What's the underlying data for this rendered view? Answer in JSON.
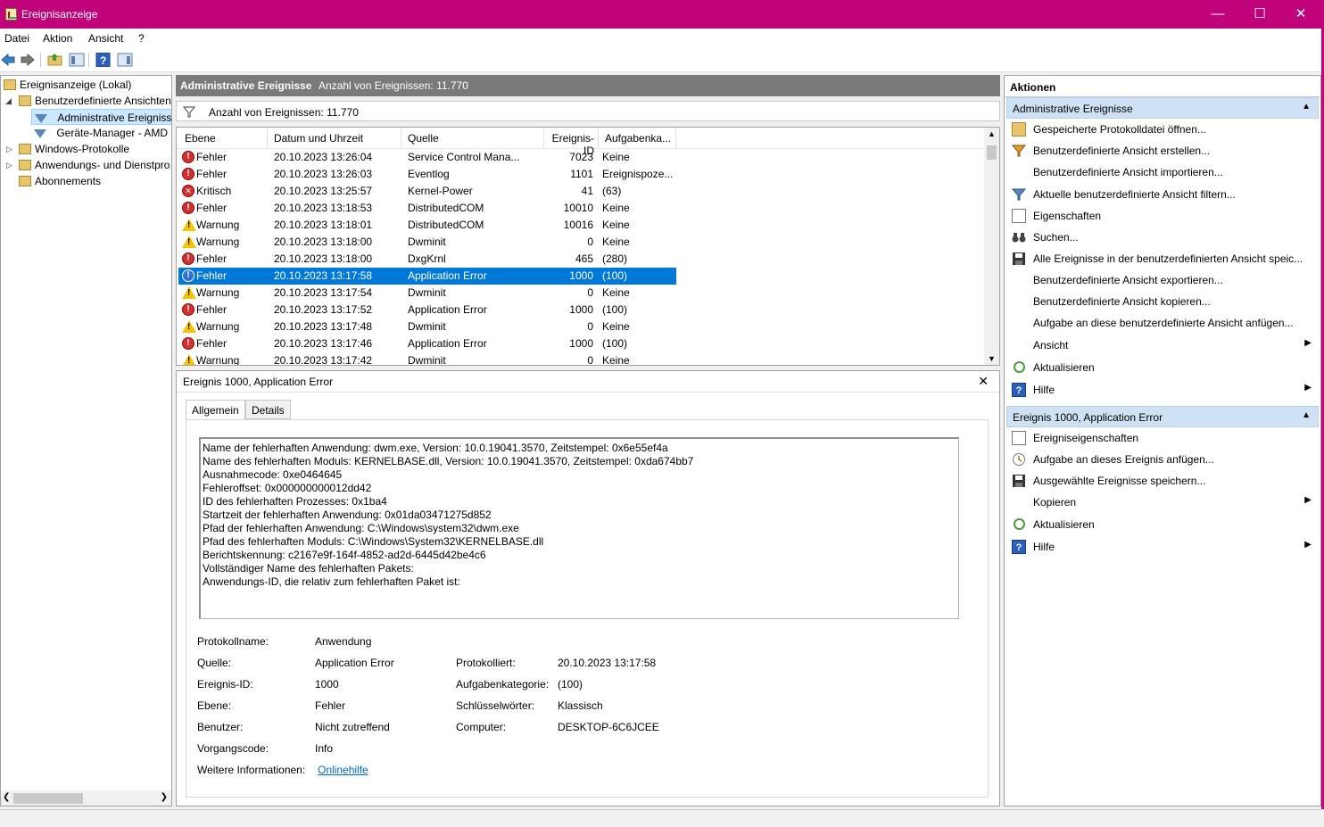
{
  "window": {
    "title": "Ereignisanzeige"
  },
  "menu": [
    "Datei",
    "Aktion",
    "Ansicht",
    "?"
  ],
  "tree": {
    "root": "Ereignisanzeige (Lokal)",
    "custom_views": "Benutzerdefinierte Ansichten",
    "admin_events": "Administrative Ereignisse",
    "device_manager": "Geräte-Manager - AMD F",
    "windows_logs": "Windows-Protokolle",
    "app_service_logs": "Anwendungs- und Dienstpro",
    "subscriptions": "Abonnements"
  },
  "center": {
    "header_title": "Administrative Ereignisse",
    "header_count": "Anzahl von Ereignissen: 11.770",
    "filter_text": "Anzahl von Ereignissen: 11.770",
    "columns": [
      "Ebene",
      "Datum und Uhrzeit",
      "Quelle",
      "Ereignis-ID",
      "Aufgabenka..."
    ],
    "rows": [
      {
        "level": "Fehler",
        "type": "error",
        "date": "20.10.2023 13:26:04",
        "source": "Service Control Mana...",
        "id": "7023",
        "task": "Keine"
      },
      {
        "level": "Fehler",
        "type": "error",
        "date": "20.10.2023 13:26:03",
        "source": "Eventlog",
        "id": "1101",
        "task": "Ereignispoze..."
      },
      {
        "level": "Kritisch",
        "type": "critical",
        "date": "20.10.2023 13:25:57",
        "source": "Kernel-Power",
        "id": "41",
        "task": "(63)"
      },
      {
        "level": "Fehler",
        "type": "error",
        "date": "20.10.2023 13:18:53",
        "source": "DistributedCOM",
        "id": "10010",
        "task": "Keine"
      },
      {
        "level": "Warnung",
        "type": "warning",
        "date": "20.10.2023 13:18:01",
        "source": "DistributedCOM",
        "id": "10016",
        "task": "Keine"
      },
      {
        "level": "Warnung",
        "type": "warning",
        "date": "20.10.2023 13:18:00",
        "source": "Dwminit",
        "id": "0",
        "task": "Keine"
      },
      {
        "level": "Fehler",
        "type": "error",
        "date": "20.10.2023 13:18:00",
        "source": "DxgKrnl",
        "id": "465",
        "task": "(280)"
      },
      {
        "level": "Fehler",
        "type": "error",
        "date": "20.10.2023 13:17:58",
        "source": "Application Error",
        "id": "1000",
        "task": "(100)",
        "selected": true
      },
      {
        "level": "Warnung",
        "type": "warning",
        "date": "20.10.2023 13:17:54",
        "source": "Dwminit",
        "id": "0",
        "task": "Keine"
      },
      {
        "level": "Fehler",
        "type": "error",
        "date": "20.10.2023 13:17:52",
        "source": "Application Error",
        "id": "1000",
        "task": "(100)"
      },
      {
        "level": "Warnung",
        "type": "warning",
        "date": "20.10.2023 13:17:48",
        "source": "Dwminit",
        "id": "0",
        "task": "Keine"
      },
      {
        "level": "Fehler",
        "type": "error",
        "date": "20.10.2023 13:17:46",
        "source": "Application Error",
        "id": "1000",
        "task": "(100)"
      },
      {
        "level": "Warnung",
        "type": "warning",
        "date": "20.10.2023 13:17:42",
        "source": "Dwminit",
        "id": "0",
        "task": "Keine"
      }
    ]
  },
  "detail": {
    "title": "Ereignis 1000, Application Error",
    "tabs": [
      "Allgemein",
      "Details"
    ],
    "description": [
      "Name der fehlerhaften Anwendung: dwm.exe, Version: 10.0.19041.3570, Zeitstempel: 0x6e55ef4a",
      "Name des fehlerhaften Moduls: KERNELBASE.dll, Version: 10.0.19041.3570, Zeitstempel: 0xda674bb7",
      "Ausnahmecode: 0xe0464645",
      "Fehleroffset: 0x000000000012dd42",
      "ID des fehlerhaften Prozesses: 0x1ba4",
      "Startzeit der fehlerhaften Anwendung: 0x01da03471275d852",
      "Pfad der fehlerhaften Anwendung: C:\\Windows\\system32\\dwm.exe",
      "Pfad des fehlerhaften Moduls: C:\\Windows\\System32\\KERNELBASE.dll",
      "Berichtskennung: c2167e9f-164f-4852-ad2d-6445d42be4c6",
      "Vollständiger Name des fehlerhaften Pakets:",
      "Anwendungs-ID, die relativ zum fehlerhaften Paket ist:"
    ],
    "fields": {
      "log_name_label": "Protokollname:",
      "log_name": "Anwendung",
      "source_label": "Quelle:",
      "source": "Application Error",
      "logged_label": "Protokolliert:",
      "logged": "20.10.2023 13:17:58",
      "event_id_label": "Ereignis-ID:",
      "event_id": "1000",
      "task_cat_label": "Aufgabenkategorie:",
      "task_cat": "(100)",
      "level_label": "Ebene:",
      "level": "Fehler",
      "keywords_label": "Schlüsselwörter:",
      "keywords": "Klassisch",
      "user_label": "Benutzer:",
      "user": "Nicht zutreffend",
      "computer_label": "Computer:",
      "computer": "DESKTOP-6C6JCEE",
      "opcode_label": "Vorgangscode:",
      "opcode": "Info",
      "more_info_label": "Weitere Informationen:",
      "more_info": "Onlinehilfe"
    }
  },
  "actions": {
    "title": "Aktionen",
    "section1": "Administrative Ereignisse",
    "items1": [
      {
        "label": "Gespeicherte Protokolldatei öffnen...",
        "icon": "folder-open-icon"
      },
      {
        "label": "Benutzerdefinierte Ansicht erstellen...",
        "icon": "filter-create-icon"
      },
      {
        "label": "Benutzerdefinierte Ansicht importieren...",
        "icon": ""
      },
      {
        "label": "Aktuelle benutzerdefinierte Ansicht filtern...",
        "icon": "filter-icon"
      },
      {
        "label": "Eigenschaften",
        "icon": "properties-icon"
      },
      {
        "label": "Suchen...",
        "icon": "binoculars-icon"
      },
      {
        "label": "Alle Ereignisse in der benutzerdefinierten Ansicht speic...",
        "icon": "save-icon"
      },
      {
        "label": "Benutzerdefinierte Ansicht exportieren...",
        "icon": ""
      },
      {
        "label": "Benutzerdefinierte Ansicht kopieren...",
        "icon": ""
      },
      {
        "label": "Aufgabe an diese benutzerdefinierte Ansicht anfügen...",
        "icon": ""
      },
      {
        "label": "Ansicht",
        "icon": "",
        "submenu": true
      },
      {
        "label": "Aktualisieren",
        "icon": "refresh-icon"
      },
      {
        "label": "Hilfe",
        "icon": "help-icon",
        "submenu": true
      }
    ],
    "section2": "Ereignis 1000, Application Error",
    "items2": [
      {
        "label": "Ereigniseigenschaften",
        "icon": "properties-icon"
      },
      {
        "label": "Aufgabe an dieses Ereignis anfügen...",
        "icon": "task-icon"
      },
      {
        "label": "Ausgewählte Ereignisse speichern...",
        "icon": "save-icon"
      },
      {
        "label": "Kopieren",
        "icon": "",
        "submenu": true
      },
      {
        "label": "Aktualisieren",
        "icon": "refresh-icon"
      },
      {
        "label": "Hilfe",
        "icon": "help-icon",
        "submenu": true
      }
    ]
  },
  "colors": {
    "titlebar": "#c0037a",
    "selection": "#0078d7",
    "section_header": "#cfe1f5",
    "link": "#0066cc"
  }
}
